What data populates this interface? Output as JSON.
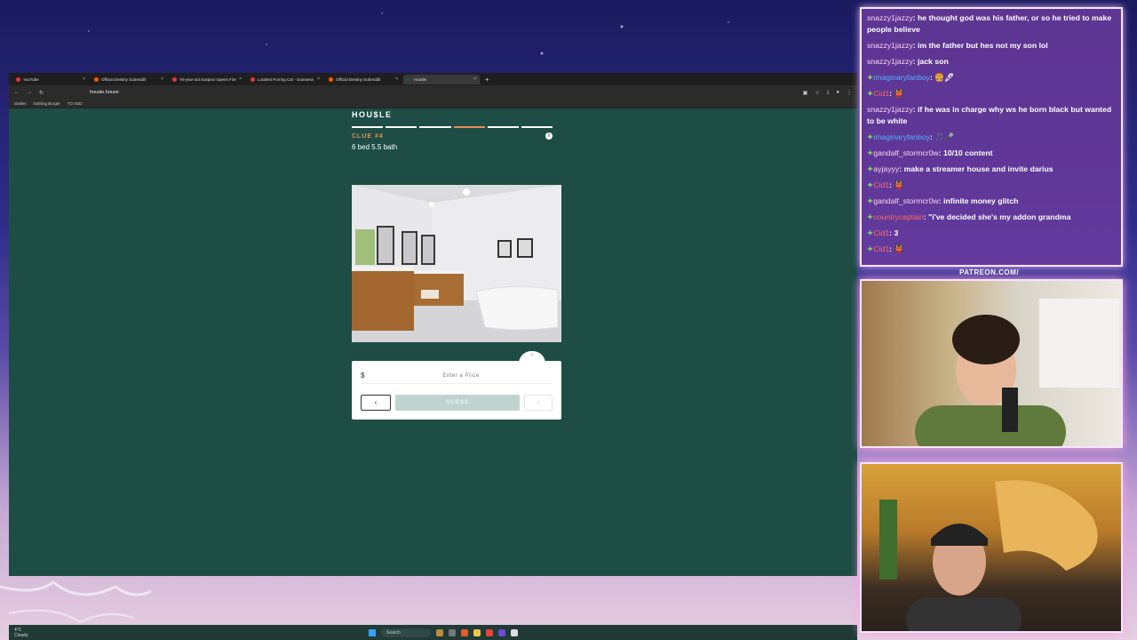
{
  "browser": {
    "tabs": [
      {
        "label": "YouTube",
        "active": false
      },
      {
        "label": "Official Destiny Subreddit",
        "active": false
      },
      {
        "label": "76-year-old Suspect Opens Fire",
        "active": false
      },
      {
        "label": "Loudest Purring Cat - Guinness",
        "active": false
      },
      {
        "label": "Official Destiny Subreddit",
        "active": false
      },
      {
        "label": "Housle",
        "active": true
      }
    ],
    "url": "housle.house",
    "bookmarks": [
      "Dailies",
      "Nothing Burger",
      "TO ADD"
    ]
  },
  "game": {
    "logo": "HOU$LE",
    "progress": {
      "total": 6,
      "current": 4
    },
    "clue_label": "CLUE #4",
    "info_icon": "i",
    "description": "6 bed 5.5 bath",
    "currency": "$",
    "price_placeholder": "Enter a Price",
    "prev_label": "‹",
    "guess_label": "GUESS",
    "next_label": "›",
    "expand_label": "^"
  },
  "taskbar": {
    "weather_temp": "4°C",
    "weather_desc": "Cloudy",
    "search_label": "Search"
  },
  "chat": {
    "messages": [
      {
        "user": "snazzy1jazzy",
        "text": "he thought god was his father, or so he tried to make people believe",
        "color": "pink"
      },
      {
        "user": "snazzy1jazzy",
        "text": "im the father but hes not my son lol",
        "color": "pink"
      },
      {
        "user": "snazzy1jazzy",
        "text": "jack son",
        "color": "pink"
      },
      {
        "user": "imaginaryfanboy",
        "text": "🍔🖊",
        "color": "blue",
        "badge": "✦"
      },
      {
        "user": "Cid1",
        "text": "👹",
        "color": "red",
        "badge": "✦"
      },
      {
        "user": "snazzy1jazzy",
        "text": "if he was in charge why ws he born black but wanted to be white",
        "color": "pink"
      },
      {
        "user": "imaginaryfanboy",
        "text": "🎵🎤",
        "color": "blue",
        "badge": "✦"
      },
      {
        "user": "gandalf_stormcr0w",
        "text": "10/10 content",
        "color": "white",
        "badge": "✦"
      },
      {
        "user": "ayjayyy",
        "text": "make a streamer house and invite darius",
        "color": "pink",
        "badge": "✦"
      },
      {
        "user": "Cid1",
        "text": "👹",
        "color": "red",
        "badge": "✦"
      },
      {
        "user": "gandalf_stormcr0w",
        "text": "infinite money glitch",
        "color": "white",
        "badge": "✦"
      },
      {
        "user": "countrycaptain",
        "text": "\"i've decided she's my addon grandma",
        "color": "red",
        "badge": "✦"
      },
      {
        "user": "Cid1",
        "text": "3",
        "color": "red",
        "badge": "✦"
      },
      {
        "user": "Cid1",
        "text": "👹",
        "color": "red",
        "badge": "✦"
      }
    ]
  },
  "overlay": {
    "patreon": "PATREON.COM/"
  },
  "colors": {
    "game_bg": "#1d4d45",
    "accent": "#e0905a",
    "chat_bg": "#6f3ca0"
  }
}
